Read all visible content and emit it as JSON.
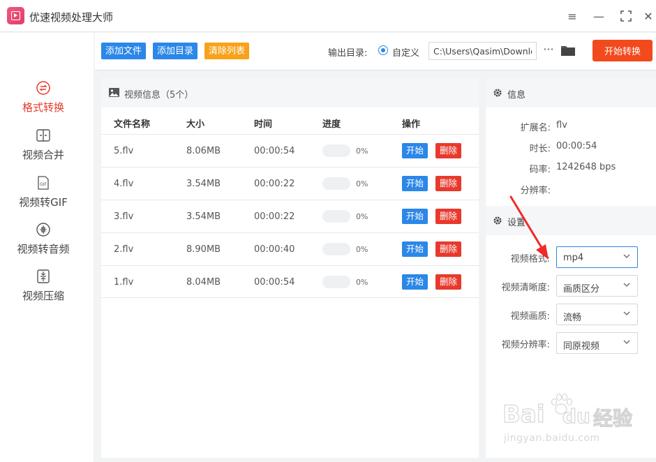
{
  "app": {
    "title": "优速视频处理大师",
    "colors": {
      "accent": "#2b87e8",
      "danger": "#e8392d",
      "warn": "#f7a21a",
      "primary_action": "#f24a1d"
    }
  },
  "window_controls": {
    "menu": "≡",
    "minimize": "—",
    "maximize": "⛶",
    "close": "✕"
  },
  "sidebar": {
    "items": [
      {
        "label": "格式转换",
        "icon": "convert-icon",
        "active": true
      },
      {
        "label": "视频合并",
        "icon": "merge-icon",
        "active": false
      },
      {
        "label": "视频转GIF",
        "icon": "gif-icon",
        "active": false,
        "icon_text": "GIF"
      },
      {
        "label": "视频转音频",
        "icon": "audio-icon",
        "active": false
      },
      {
        "label": "视频压缩",
        "icon": "compress-icon",
        "active": false
      }
    ]
  },
  "toolbar": {
    "add_file": "添加文件",
    "add_dir": "添加目录",
    "clear_list": "清除列表",
    "output_label": "输出目录:",
    "radio_label": "自定义",
    "path_value": "C:\\Users\\Qasim\\Downlo",
    "more": "···",
    "start_all": "开始转换"
  },
  "file_panel": {
    "title": "视频信息（5个）",
    "headers": {
      "name": "文件名称",
      "size": "大小",
      "time": "时间",
      "progress": "进度",
      "ops": "操作"
    },
    "rows": [
      {
        "name": "5.flv",
        "size": "8.06MB",
        "time": "00:00:54",
        "progress": "0%",
        "start": "开始",
        "delete": "删除"
      },
      {
        "name": "4.flv",
        "size": "3.54MB",
        "time": "00:00:22",
        "progress": "0%",
        "start": "开始",
        "delete": "删除"
      },
      {
        "name": "3.flv",
        "size": "3.54MB",
        "time": "00:00:22",
        "progress": "0%",
        "start": "开始",
        "delete": "删除"
      },
      {
        "name": "2.flv",
        "size": "8.90MB",
        "time": "00:00:40",
        "progress": "0%",
        "start": "开始",
        "delete": "删除"
      },
      {
        "name": "1.flv",
        "size": "8.04MB",
        "time": "00:00:54",
        "progress": "0%",
        "start": "开始",
        "delete": "删除"
      }
    ]
  },
  "info": {
    "title": "信息",
    "ext_label": "扩展名:",
    "ext_value": "flv",
    "duration_label": "时长:",
    "duration_value": "00:00:54",
    "bitrate_label": "码率:",
    "bitrate_value": "1242648 bps",
    "resolution_label": "分辨率:",
    "resolution_value": ""
  },
  "settings": {
    "title": "设置",
    "format_label": "视频格式:",
    "format_value": "mp4",
    "clarity_label": "视频清晰度:",
    "clarity_value": "画质区分",
    "quality_label": "视频画质:",
    "quality_value": "流畅",
    "resolution_label": "视频分辨率:",
    "resolution_value": "同原视频"
  },
  "watermark": {
    "brand": "Bai",
    "brand2": "du",
    "cn": "经验",
    "url": "jingyan.baidu.com"
  }
}
